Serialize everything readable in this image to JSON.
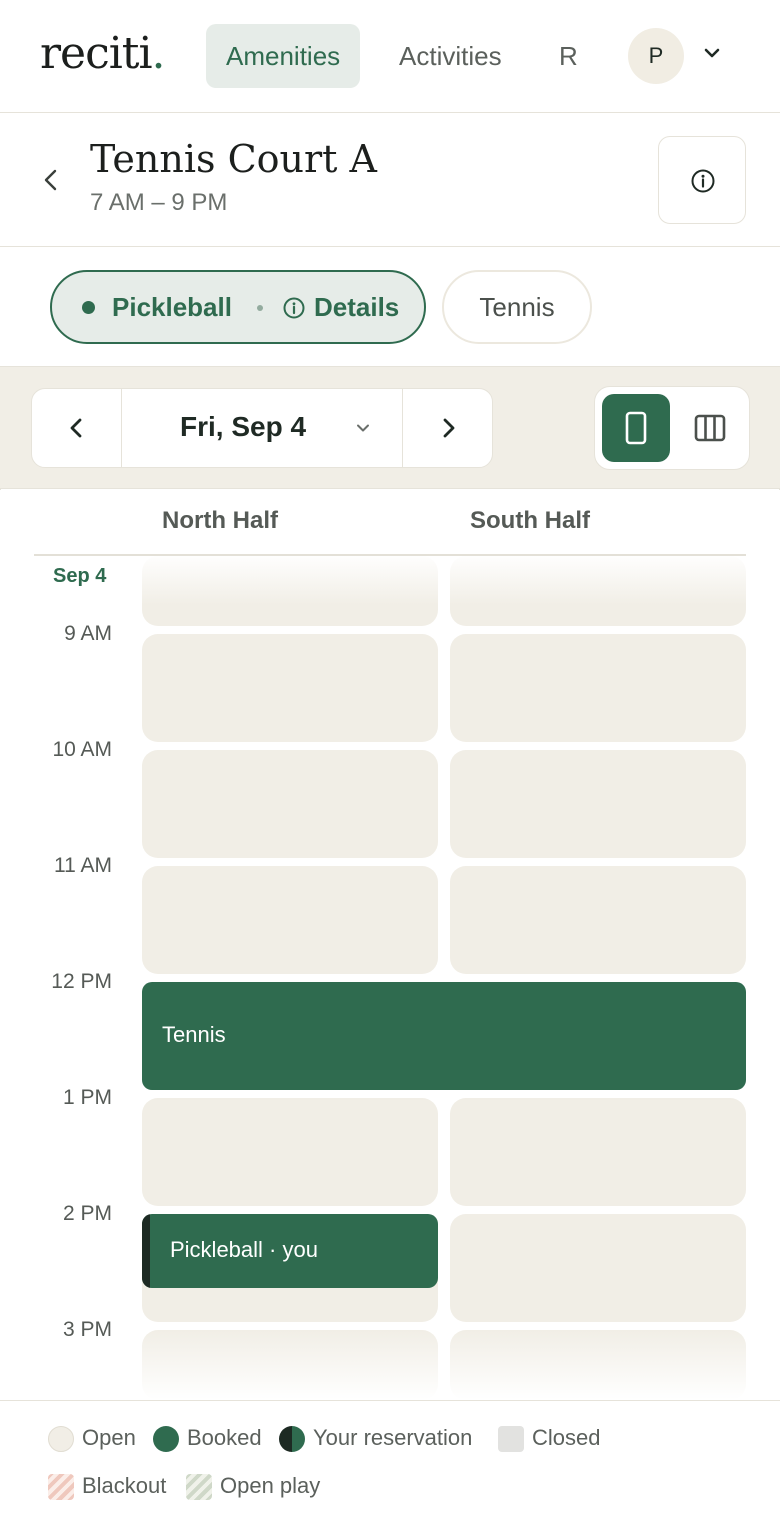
{
  "nav": {
    "logo_text": "reciti",
    "logo_dot": ".",
    "tabs": [
      {
        "label": "Amenities",
        "active": true
      },
      {
        "label": "Activities",
        "active": false
      },
      {
        "label": "R",
        "active": false
      }
    ],
    "avatar_initial": "P"
  },
  "header": {
    "title": "Tennis Court A",
    "hours": "7 AM – 9 PM"
  },
  "activities": {
    "active": {
      "label": "Pickleball",
      "details_label": "Details"
    },
    "other": {
      "label": "Tennis"
    }
  },
  "date_nav": {
    "date": "Fri, Sep 4",
    "view_mode": "single-column"
  },
  "calendar": {
    "columns": [
      "North Half",
      "South Half"
    ],
    "date_label": "Sep 4",
    "times": [
      "9 AM",
      "10 AM",
      "11 AM",
      "12 PM",
      "1 PM",
      "2 PM",
      "3 PM"
    ],
    "bookings": [
      {
        "label": "Tennis",
        "span": "both halves",
        "time": "12 PM"
      },
      {
        "label": "Pickleball · you",
        "span": "North Half",
        "time": "2 PM",
        "own": true
      }
    ]
  },
  "legend": {
    "open": "Open",
    "booked": "Booked",
    "your_reservation": "Your reservation",
    "closed": "Closed",
    "blackout": "Blackout",
    "open_play": "Open play"
  },
  "colors": {
    "brand_green": "#2f6b4f",
    "slot_beige": "#f1eee6",
    "own_marker": "#1d2a23"
  }
}
